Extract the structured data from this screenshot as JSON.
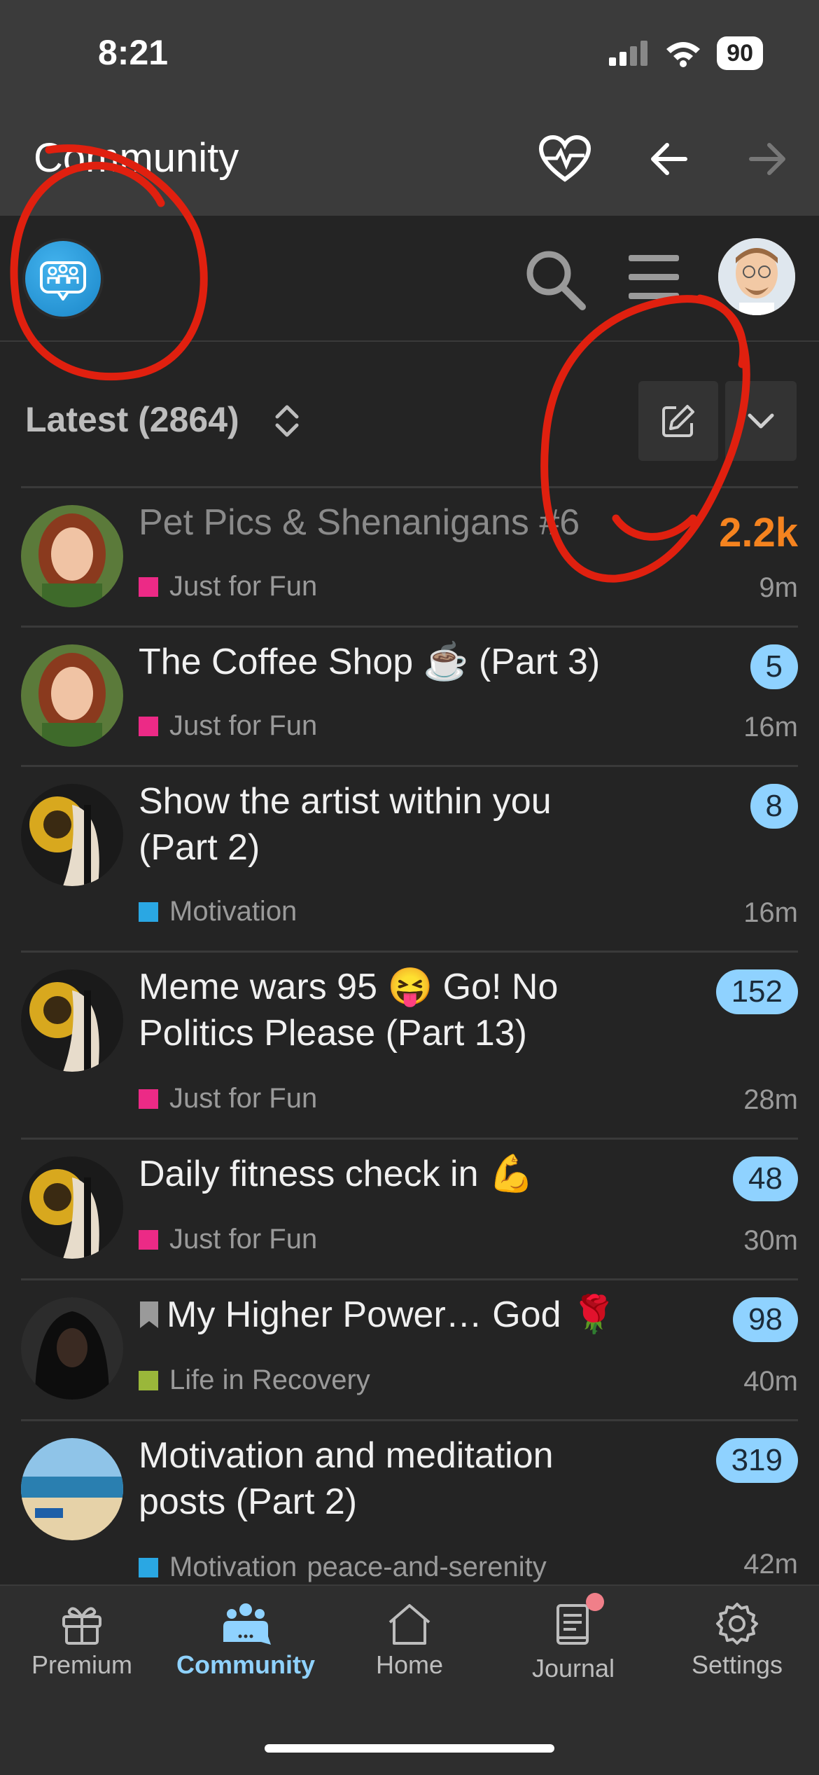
{
  "status_bar": {
    "time": "8:21",
    "battery": "90"
  },
  "app_header": {
    "title": "Community"
  },
  "filter_bar": {
    "latest_label": "Latest (2864)"
  },
  "topics": [
    {
      "title": "Pet Pics & Shenanigans #6",
      "category": "Just for Fun",
      "category_color": "#ec2a86",
      "age": "9m",
      "count": "2.2k",
      "count_style": "hot",
      "read": true
    },
    {
      "title": "The Coffee Shop ☕ (Part 3)",
      "category": "Just for Fun",
      "category_color": "#ec2a86",
      "age": "16m",
      "count": "5"
    },
    {
      "title_line1": "Show the artist within you",
      "title_line2": "(Part 2)",
      "category": "Motivation",
      "category_color": "#2aa7e3",
      "age": "16m",
      "count": "8"
    },
    {
      "title_line1": "Meme wars 95 😝 Go! No",
      "title_line2": "Politics Please (Part 13)",
      "category": "Just for Fun",
      "category_color": "#ec2a86",
      "age": "28m",
      "count": "152"
    },
    {
      "title": "Daily fitness check in 💪",
      "category": "Just for Fun",
      "category_color": "#ec2a86",
      "age": "30m",
      "count": "48"
    },
    {
      "title": "My Higher Power… God 🌹",
      "category": "Life in Recovery",
      "category_color": "#9ab73a",
      "age": "40m",
      "count": "98"
    },
    {
      "title_line1": "Motivation and meditation",
      "title_line2": "posts (Part 2)",
      "category": "Motivation",
      "category_color": "#2aa7e3",
      "tag": "peace-and-serenity",
      "age": "42m",
      "count": "319"
    }
  ],
  "tabbar": {
    "tabs": [
      {
        "label": "Premium",
        "icon": "gift-icon"
      },
      {
        "label": "Community",
        "icon": "community-icon",
        "active": true
      },
      {
        "label": "Home",
        "icon": "home-icon"
      },
      {
        "label": "Journal",
        "icon": "journal-icon",
        "has_notification_dot": true
      },
      {
        "label": "Settings",
        "icon": "gear-icon"
      }
    ]
  },
  "colors": {
    "accent_blue": "#8fd2ff",
    "hot_orange": "#f5831f",
    "annotation_red": "#e0200f"
  }
}
